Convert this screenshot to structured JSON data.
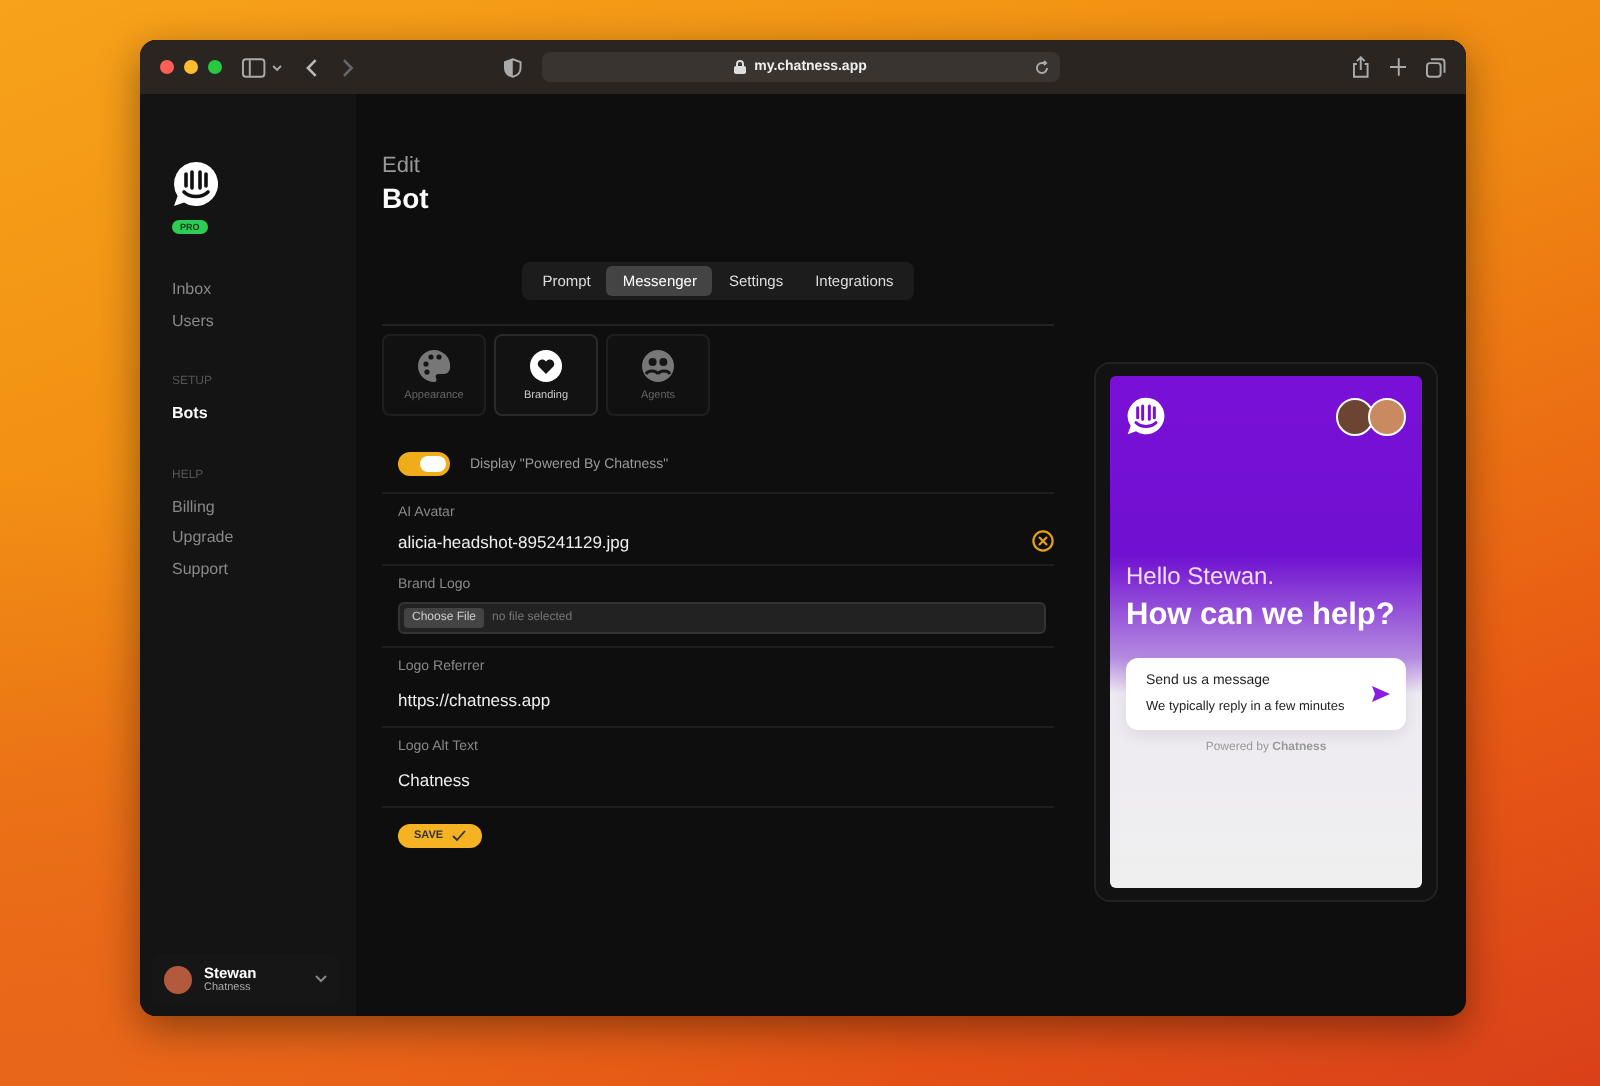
{
  "browser": {
    "url": "my.chatness.app"
  },
  "sidebar": {
    "badge": "PRO",
    "groups": [
      {
        "items": [
          {
            "label": "Inbox",
            "selected": false
          },
          {
            "label": "Users",
            "selected": false
          }
        ]
      },
      {
        "heading": "SETUP",
        "items": [
          {
            "label": "Bots",
            "selected": true
          }
        ]
      },
      {
        "heading": "HELP",
        "items": [
          {
            "label": "Billing",
            "selected": false
          },
          {
            "label": "Upgrade",
            "selected": false
          },
          {
            "label": "Support",
            "selected": false
          }
        ]
      }
    ],
    "user": {
      "name": "Stewan",
      "org": "Chatness"
    }
  },
  "page": {
    "eyebrow": "Edit",
    "title": "Bot"
  },
  "tabs": [
    {
      "label": "Prompt",
      "selected": false
    },
    {
      "label": "Messenger",
      "selected": true
    },
    {
      "label": "Settings",
      "selected": false
    },
    {
      "label": "Integrations",
      "selected": false
    }
  ],
  "sections": [
    {
      "kind": "palette",
      "label": "Appearance",
      "selected": false
    },
    {
      "kind": "heart",
      "label": "Branding",
      "selected": true
    },
    {
      "kind": "agents",
      "label": "Agents",
      "selected": false
    }
  ],
  "toggle": {
    "label": "Display \"Powered By Chatness\"",
    "on": true
  },
  "fields": [
    {
      "kind": "clearable",
      "label": "AI Avatar",
      "value": "alicia-headshot-895241129.jpg"
    },
    {
      "kind": "file",
      "label": "Brand Logo",
      "button": "Choose File",
      "status": "no file selected"
    },
    {
      "kind": "text",
      "label": "Logo Referrer",
      "value": "https://chatness.app"
    },
    {
      "kind": "text",
      "label": "Logo Alt Text",
      "value": "Chatness"
    }
  ],
  "save": "SAVE",
  "preview": {
    "greeting": "Hello Stewan.",
    "headline": "How can we help?",
    "card_title": "Send us a message",
    "card_subtitle": "We typically reply in a few minutes",
    "powered_by": "Powered by **Chatness**"
  }
}
